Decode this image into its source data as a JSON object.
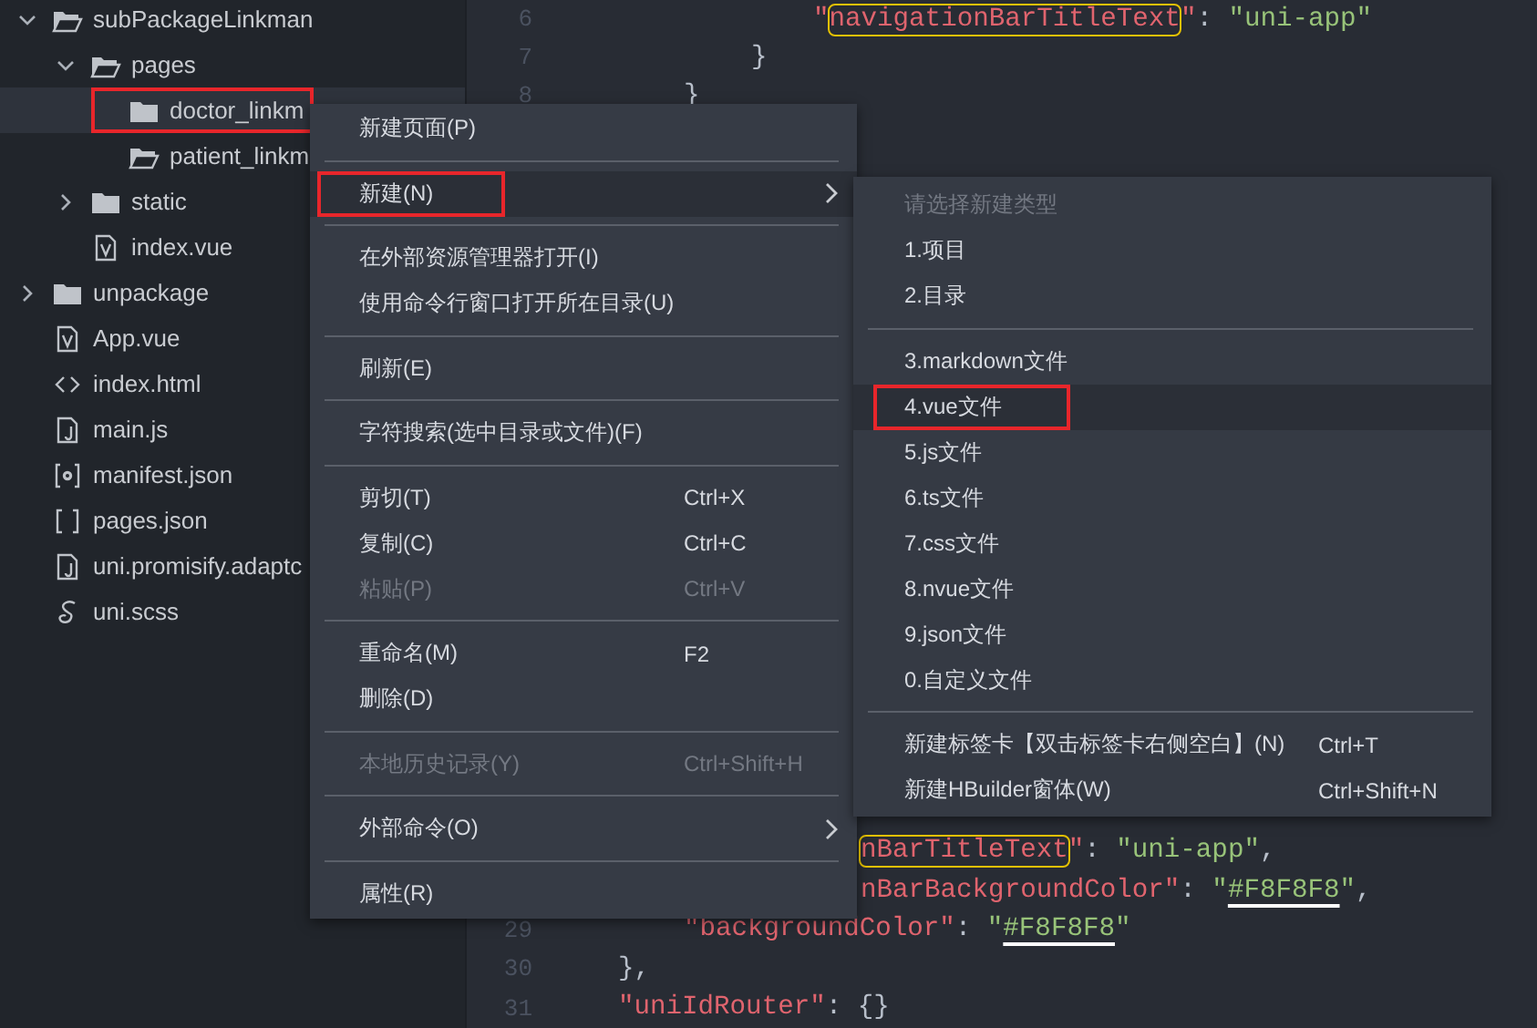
{
  "explorer": {
    "items": [
      {
        "label": "subPackageLinkman",
        "kind": "folder",
        "expandable": true,
        "expanded": true,
        "selected": false,
        "annotated": false,
        "children": [
          {
            "label": "pages",
            "kind": "folder",
            "expandable": true,
            "expanded": true,
            "selected": false,
            "annotated": false,
            "children": [
              {
                "label": "doctor_linkm",
                "kind": "folder",
                "expandable": false,
                "expanded": false,
                "selected": true,
                "annotated": true
              },
              {
                "label": "patient_linkm",
                "kind": "folder",
                "expandable": false,
                "expanded": true,
                "selected": false,
                "annotated": false
              }
            ]
          },
          {
            "label": "static",
            "kind": "folder",
            "expandable": true,
            "expanded": false,
            "selected": false,
            "annotated": false
          },
          {
            "label": "index.vue",
            "kind": "vue",
            "selected": false,
            "annotated": false
          }
        ]
      },
      {
        "label": "unpackage",
        "kind": "folder",
        "expandable": true,
        "expanded": false,
        "selected": false,
        "annotated": false
      },
      {
        "label": "App.vue",
        "kind": "vue",
        "selected": false,
        "annotated": false
      },
      {
        "label": "index.html",
        "kind": "html",
        "selected": false,
        "annotated": false
      },
      {
        "label": "main.js",
        "kind": "js",
        "selected": false,
        "annotated": false
      },
      {
        "label": "manifest.json",
        "kind": "manifest",
        "selected": false,
        "annotated": false
      },
      {
        "label": "pages.json",
        "kind": "json",
        "selected": false,
        "annotated": false
      },
      {
        "label": "uni.promisify.adaptc",
        "kind": "js",
        "selected": false,
        "annotated": false
      },
      {
        "label": "uni.scss",
        "kind": "scss",
        "selected": false,
        "annotated": false
      }
    ]
  },
  "editor": {
    "upper_lines": [
      {
        "number": "6",
        "segments": [
          {
            "text": "\"",
            "kind": "key"
          },
          {
            "text": "navigationBarTitleText",
            "kind": "boxed-key"
          },
          {
            "text": "\"",
            "kind": "key"
          },
          {
            "text": ": ",
            "kind": "punct"
          },
          {
            "text": "\"uni-app\"",
            "kind": "string"
          }
        ]
      },
      {
        "number": "7",
        "segments": [
          {
            "text": "}",
            "kind": "punct"
          }
        ]
      },
      {
        "number": "8",
        "segments": [
          {
            "text": "}",
            "kind": "punct"
          }
        ]
      }
    ],
    "lower_lines": [
      {
        "segments": [
          {
            "text": "nBarTitleText",
            "kind": "boxed-key"
          },
          {
            "text": "\"",
            "kind": "key"
          },
          {
            "text": ": ",
            "kind": "punct"
          },
          {
            "text": "\"uni-app\"",
            "kind": "string"
          },
          {
            "text": ",",
            "kind": "punct"
          }
        ]
      },
      {
        "segments": [
          {
            "text": "nBarBackgroundColor\"",
            "kind": "key"
          },
          {
            "text": ": ",
            "kind": "punct"
          },
          {
            "text": "\"",
            "kind": "string"
          },
          {
            "text": "#F8F8F8",
            "kind": "underlined-string"
          },
          {
            "text": "\"",
            "kind": "string"
          },
          {
            "text": ",",
            "kind": "punct"
          }
        ]
      },
      {
        "number": "29",
        "segments": [
          {
            "text": "\"backgroundColor\"",
            "kind": "key"
          },
          {
            "text": ": ",
            "kind": "punct"
          },
          {
            "text": "\"",
            "kind": "string"
          },
          {
            "text": "#F8F8F8",
            "kind": "underlined-string"
          },
          {
            "text": "\"",
            "kind": "string"
          }
        ]
      },
      {
        "number": "30",
        "segments": [
          {
            "text": "},",
            "kind": "punct"
          }
        ]
      },
      {
        "number": "31",
        "segments": [
          {
            "text": "\"uniIdRouter\"",
            "kind": "key"
          },
          {
            "text": ": ",
            "kind": "punct"
          },
          {
            "text": "{}",
            "kind": "punct"
          }
        ]
      }
    ]
  },
  "context_menu": {
    "items": [
      {
        "kind": "item",
        "label": "新建页面(P)",
        "selected": false,
        "disabled": false,
        "annotated": false,
        "submenu": false
      },
      {
        "kind": "separator"
      },
      {
        "kind": "item",
        "label": "新建(N)",
        "selected": true,
        "disabled": false,
        "annotated": true,
        "submenu": true
      },
      {
        "kind": "separator"
      },
      {
        "kind": "item",
        "label": "在外部资源管理器打开(I)",
        "selected": false,
        "disabled": false,
        "annotated": false,
        "submenu": false
      },
      {
        "kind": "item",
        "label": "使用命令行窗口打开所在目录(U)",
        "selected": false,
        "disabled": false,
        "annotated": false,
        "submenu": false
      },
      {
        "kind": "separator"
      },
      {
        "kind": "item",
        "label": "刷新(E)",
        "selected": false,
        "disabled": false,
        "annotated": false,
        "submenu": false
      },
      {
        "kind": "separator"
      },
      {
        "kind": "item",
        "label": "字符搜索(选中目录或文件)(F)",
        "selected": false,
        "disabled": false,
        "annotated": false,
        "submenu": false
      },
      {
        "kind": "separator"
      },
      {
        "kind": "item",
        "label": "剪切(T)",
        "shortcut": "Ctrl+X",
        "selected": false,
        "disabled": false,
        "annotated": false,
        "submenu": false
      },
      {
        "kind": "item",
        "label": "复制(C)",
        "shortcut": "Ctrl+C",
        "selected": false,
        "disabled": false,
        "annotated": false,
        "submenu": false
      },
      {
        "kind": "item",
        "label": "粘贴(P)",
        "shortcut": "Ctrl+V",
        "selected": false,
        "disabled": true,
        "annotated": false,
        "submenu": false
      },
      {
        "kind": "separator"
      },
      {
        "kind": "item",
        "label": "重命名(M)",
        "shortcut": "F2",
        "selected": false,
        "disabled": false,
        "annotated": false,
        "submenu": false
      },
      {
        "kind": "item",
        "label": "删除(D)",
        "selected": false,
        "disabled": false,
        "annotated": false,
        "submenu": false
      },
      {
        "kind": "separator"
      },
      {
        "kind": "item",
        "label": "本地历史记录(Y)",
        "shortcut": "Ctrl+Shift+H",
        "selected": false,
        "disabled": true,
        "annotated": false,
        "submenu": false
      },
      {
        "kind": "separator"
      },
      {
        "kind": "item",
        "label": "外部命令(O)",
        "selected": false,
        "disabled": false,
        "annotated": false,
        "submenu": true
      },
      {
        "kind": "separator"
      },
      {
        "kind": "item",
        "label": "属性(R)",
        "selected": false,
        "disabled": false,
        "annotated": false,
        "submenu": false
      }
    ]
  },
  "submenu": {
    "items": [
      {
        "kind": "item",
        "label": "请选择新建类型",
        "selected": false,
        "disabled": true,
        "annotated": false,
        "submenu": false
      },
      {
        "kind": "item",
        "label": "1.项目",
        "selected": false,
        "disabled": false,
        "annotated": false,
        "submenu": false
      },
      {
        "kind": "item",
        "label": "2.目录",
        "selected": false,
        "disabled": false,
        "annotated": false,
        "submenu": false
      },
      {
        "kind": "separator"
      },
      {
        "kind": "item",
        "label": "3.markdown文件",
        "selected": false,
        "disabled": false,
        "annotated": false,
        "submenu": false
      },
      {
        "kind": "item",
        "label": "4.vue文件",
        "selected": true,
        "disabled": false,
        "annotated": true,
        "submenu": false
      },
      {
        "kind": "item",
        "label": "5.js文件",
        "selected": false,
        "disabled": false,
        "annotated": false,
        "submenu": false
      },
      {
        "kind": "item",
        "label": "6.ts文件",
        "selected": false,
        "disabled": false,
        "annotated": false,
        "submenu": false
      },
      {
        "kind": "item",
        "label": "7.css文件",
        "selected": false,
        "disabled": false,
        "annotated": false,
        "submenu": false
      },
      {
        "kind": "item",
        "label": "8.nvue文件",
        "selected": false,
        "disabled": false,
        "annotated": false,
        "submenu": false
      },
      {
        "kind": "item",
        "label": "9.json文件",
        "selected": false,
        "disabled": false,
        "annotated": false,
        "submenu": false
      },
      {
        "kind": "item",
        "label": "0.自定义文件",
        "selected": false,
        "disabled": false,
        "annotated": false,
        "submenu": false
      },
      {
        "kind": "separator"
      },
      {
        "kind": "item",
        "label": "新建标签卡【双击标签卡右侧空白】(N)",
        "shortcut": "Ctrl+T",
        "selected": false,
        "disabled": false,
        "annotated": false,
        "submenu": false
      },
      {
        "kind": "item",
        "label": "新建HBuilder窗体(W)",
        "shortcut": "Ctrl+Shift+N",
        "selected": false,
        "disabled": false,
        "annotated": false,
        "submenu": false
      }
    ]
  }
}
